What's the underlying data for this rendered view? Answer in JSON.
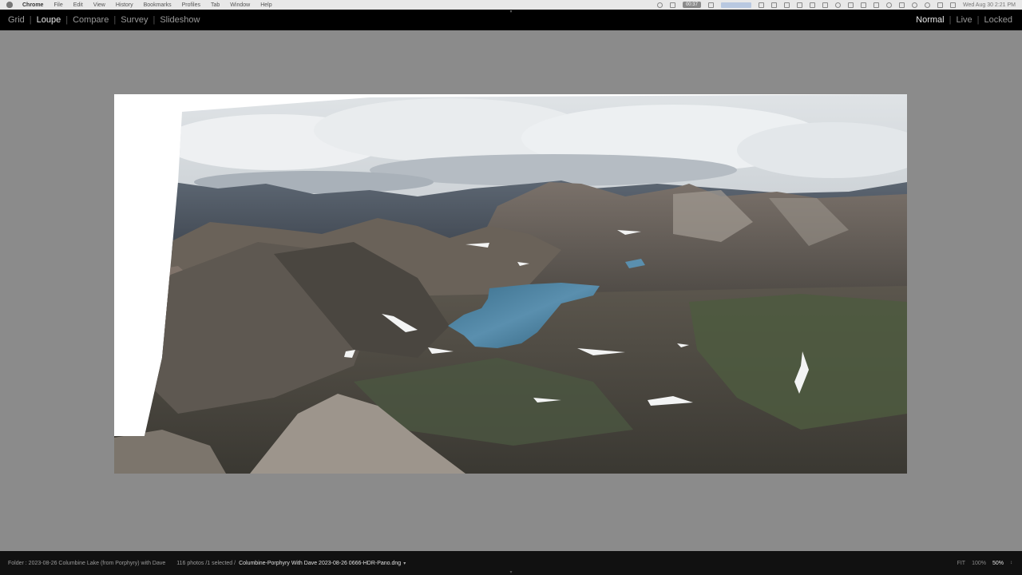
{
  "menubar": {
    "app": "Chrome",
    "items": [
      "File",
      "Edit",
      "View",
      "History",
      "Bookmarks",
      "Profiles",
      "Tab",
      "Window",
      "Help"
    ],
    "recording": "00:37",
    "datetime": "Wed Aug 30  2:21 PM"
  },
  "views": {
    "items": [
      {
        "label": "Grid",
        "active": false
      },
      {
        "label": "Loupe",
        "active": true
      },
      {
        "label": "Compare",
        "active": false
      },
      {
        "label": "Survey",
        "active": false
      },
      {
        "label": "Slideshow",
        "active": false
      }
    ]
  },
  "modes": {
    "items": [
      {
        "label": "Normal",
        "active": true
      },
      {
        "label": "Live",
        "active": false
      },
      {
        "label": "Locked",
        "active": false
      }
    ]
  },
  "status": {
    "folder": "Folder : 2023-08-26 Columbine Lake (from Porphyry) with Dave",
    "count": "116 photos /1 selected /",
    "filename": "Columbine-Porphyry With Dave 2023-08-26 0666-HDR-Pano.dng",
    "dropdown": "▾"
  },
  "zoom": {
    "fit": "FIT",
    "hundred": "100%",
    "current": "50%",
    "updown": "↕"
  },
  "colors": {
    "accent_active": "#e8e8e8",
    "inactive": "#9a9a9a",
    "background": "#8b8b8b"
  },
  "icons": [
    "apple-icon",
    "search-icon",
    "wifi-icon",
    "battery-icon",
    "bluetooth-icon"
  ]
}
